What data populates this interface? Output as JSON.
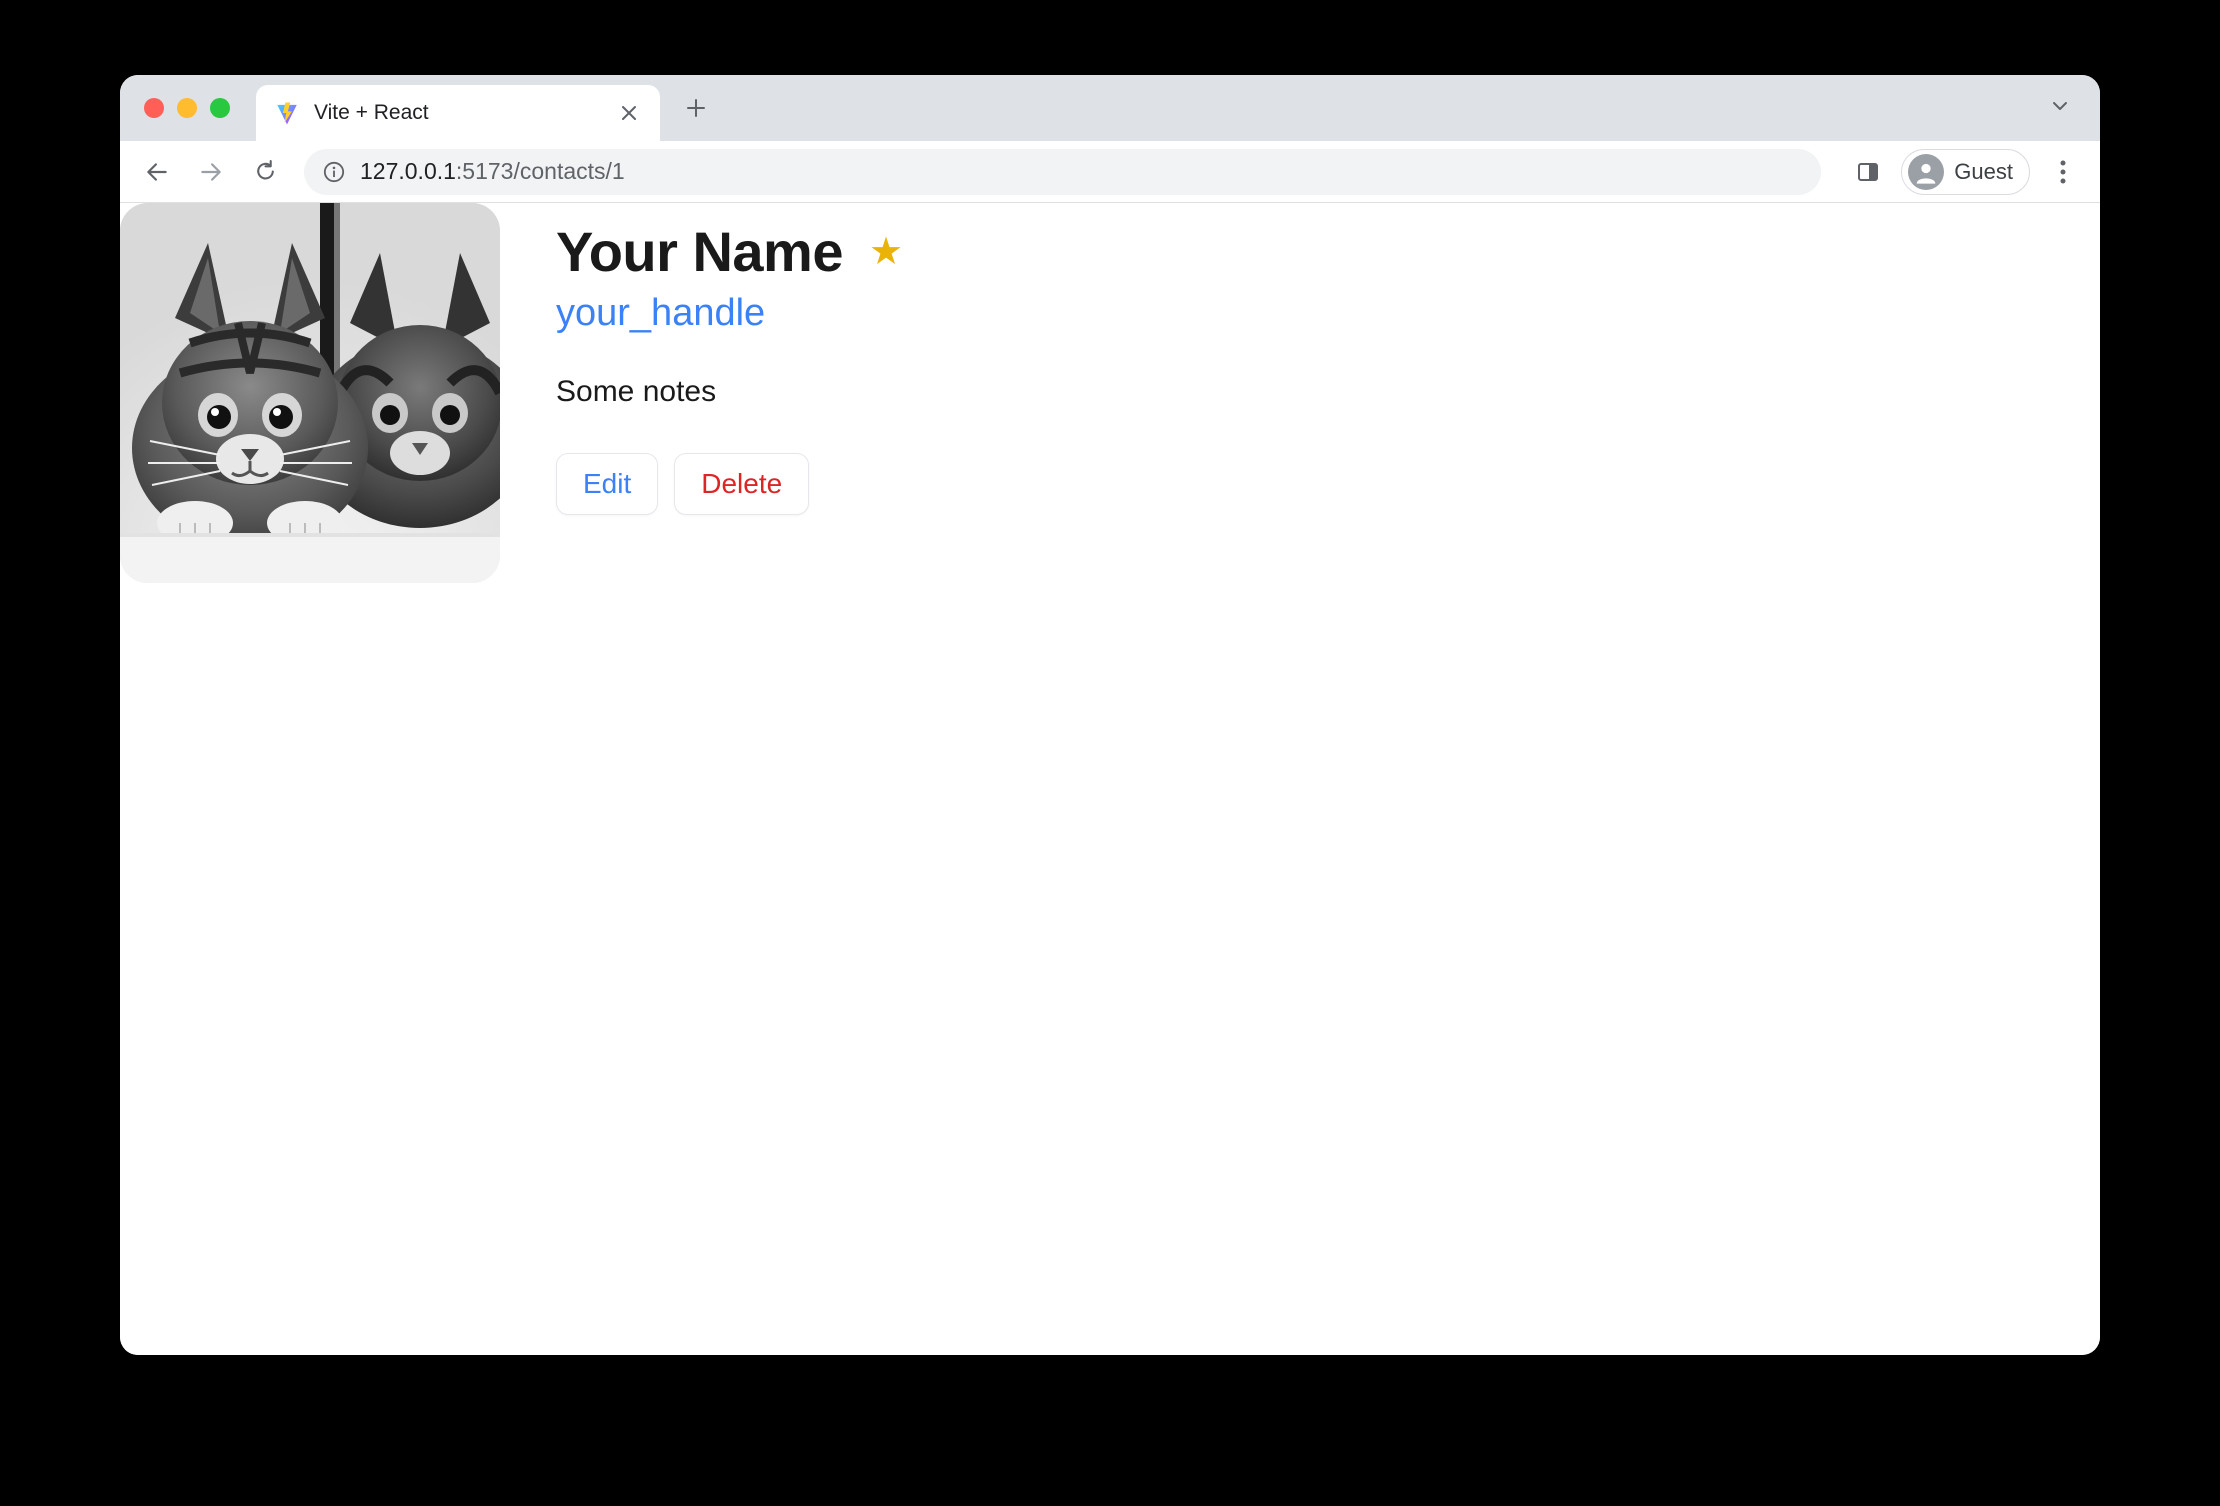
{
  "browser": {
    "tab_title": "Vite + React",
    "url_host": "127.0.0.1",
    "url_port_path": ":5173/contacts/1",
    "profile_label": "Guest"
  },
  "contact": {
    "name": "Your Name",
    "handle": "your_handle",
    "notes": "Some notes",
    "favorite": "★",
    "edit_label": "Edit",
    "delete_label": "Delete"
  }
}
